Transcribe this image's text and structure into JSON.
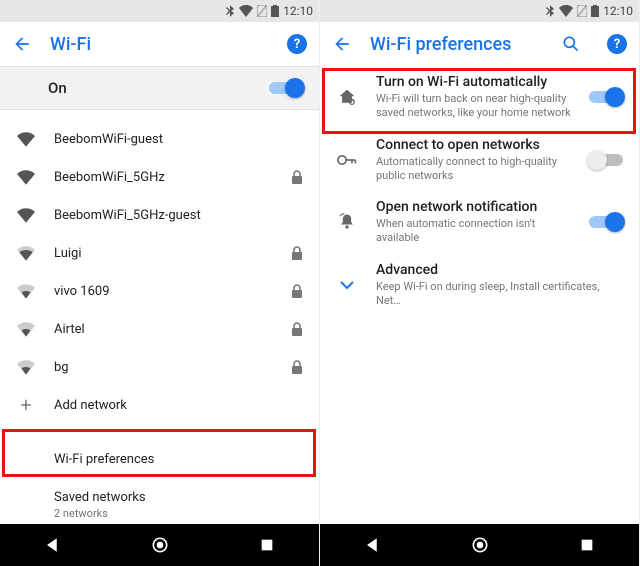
{
  "status": {
    "time": "12:10"
  },
  "left": {
    "title": "Wi-Fi",
    "on_label": "On",
    "networks": [
      {
        "ssid": "BeebomWiFi-guest",
        "strength": 4,
        "locked": false
      },
      {
        "ssid": "BeebomWiFi_5GHz",
        "strength": 4,
        "locked": true
      },
      {
        "ssid": "BeebomWiFi_5GHz-guest",
        "strength": 4,
        "locked": false
      },
      {
        "ssid": "Luigi",
        "strength": 3,
        "locked": true
      },
      {
        "ssid": "vivo 1609",
        "strength": 2,
        "locked": true
      },
      {
        "ssid": "Airtel",
        "strength": 2,
        "locked": true
      },
      {
        "ssid": "bg",
        "strength": 2,
        "locked": true
      }
    ],
    "add_network": "Add network",
    "wifi_preferences": "Wi-Fi preferences",
    "saved_networks": {
      "title": "Saved networks",
      "sub": "2 networks"
    }
  },
  "right": {
    "title": "Wi-Fi preferences",
    "items": {
      "auto": {
        "title": "Turn on Wi-Fi automatically",
        "sub": "Wi-Fi will turn back on near high-quality saved networks, like your home network",
        "on": true
      },
      "open": {
        "title": "Connect to open networks",
        "sub": "Automatically connect to high-quality public networks",
        "on": false
      },
      "notify": {
        "title": "Open network notification",
        "sub": "When automatic connection isn't available",
        "on": true
      },
      "advanced": {
        "title": "Advanced",
        "sub": "Keep Wi-Fi on during sleep, Install certificates, Net…"
      }
    }
  }
}
